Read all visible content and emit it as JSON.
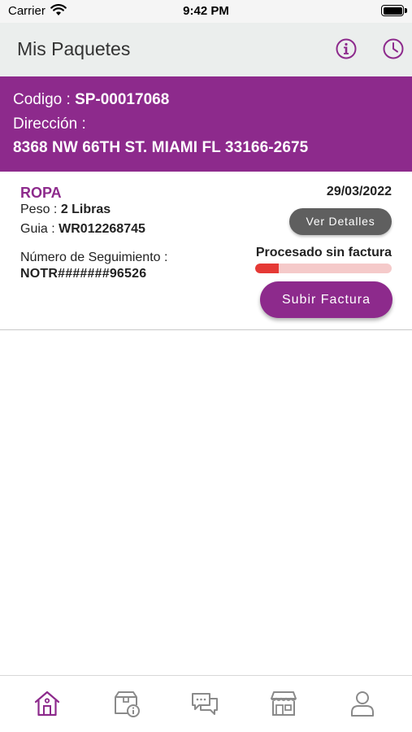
{
  "status_bar": {
    "carrier": "Carrier",
    "time": "9:42 PM"
  },
  "header": {
    "title": "Mis Paquetes",
    "icons": [
      "info-icon",
      "clock-icon"
    ]
  },
  "address": {
    "codigo_label": "Codigo :",
    "codigo_value": "SP-00017068",
    "direccion_label": "Dirección :",
    "direccion_value": "8368 NW 66TH ST. MIAMI FL 33166-2675"
  },
  "package": {
    "name": "ROPA",
    "date": "29/03/2022",
    "peso_label": "Peso :",
    "peso_value": "2 Libras",
    "guia_label": "Guia :",
    "guia_value": "WR012268745",
    "tracking_label": "Número de Seguimiento :",
    "tracking_value": "NOTR#######96526",
    "details_button": "Ver Detalles",
    "status": "Procesado sin factura",
    "progress": 0.17,
    "upload_button": "Subir Factura"
  },
  "tabs": [
    {
      "name": "home-icon",
      "active": true
    },
    {
      "name": "package-info-icon",
      "active": false
    },
    {
      "name": "chat-icon",
      "active": false
    },
    {
      "name": "store-icon",
      "active": false
    },
    {
      "name": "user-icon",
      "active": false
    }
  ],
  "colors": {
    "brand": "#8d2a8c",
    "inactive_icon": "#8a8a8a",
    "progress_fill": "#e53935",
    "progress_track": "#f5caca"
  }
}
